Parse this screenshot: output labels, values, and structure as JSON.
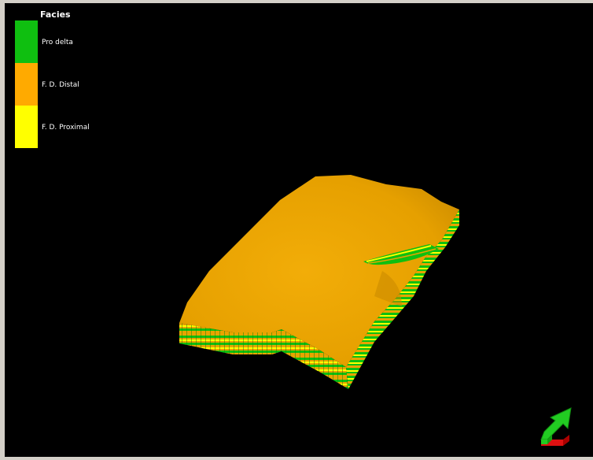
{
  "legend": {
    "title": "Facies",
    "items": [
      {
        "label": "Pro delta",
        "color": "#0fbf10"
      },
      {
        "label": "F. D. Distal",
        "color": "#ffaa00"
      },
      {
        "label": "F. D. Proximal",
        "color": "#ffff00"
      }
    ]
  },
  "model": {
    "top_surface_color": "#e8a400",
    "layer_colors": [
      "#0fbf10",
      "#e8a400",
      "#ffff00"
    ]
  },
  "orientation_indicator": {
    "icon": "north-arrow-icon",
    "arrow_color": "#22cc22",
    "base_color": "#dd1111"
  }
}
